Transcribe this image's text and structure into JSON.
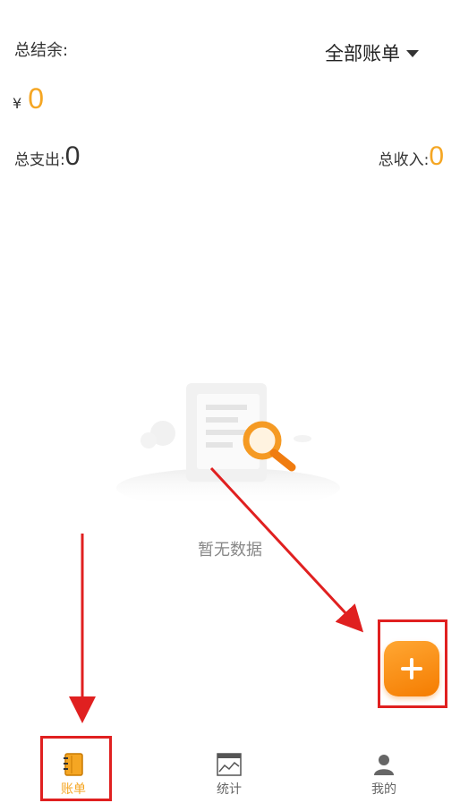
{
  "summary": {
    "balance_label": "总结余:",
    "currency_symbol": "¥",
    "balance_value": "0",
    "filter_label": "全部账单",
    "expense_label": "总支出:",
    "expense_value": "0",
    "income_label": "总收入:",
    "income_value": "0"
  },
  "empty_state": {
    "illustration": "document-search-illustration",
    "message": "暂无数据"
  },
  "fab": {
    "icon": "plus-icon"
  },
  "tabs": [
    {
      "label": "账单",
      "icon": "notebook-icon",
      "active": true
    },
    {
      "label": "统计",
      "icon": "chart-icon",
      "active": false
    },
    {
      "label": "我的",
      "icon": "user-icon",
      "active": false
    }
  ],
  "colors": {
    "accent": "#f5a623",
    "fab_gradient_start": "#ffa733",
    "fab_gradient_end": "#f57c00",
    "annotation": "#e02020"
  }
}
